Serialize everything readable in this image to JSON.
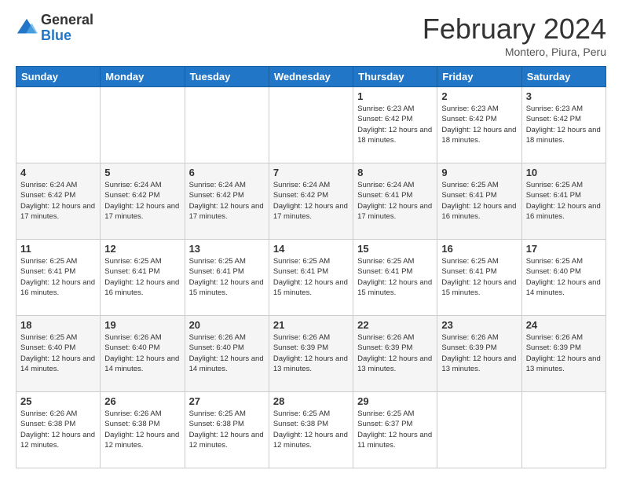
{
  "logo": {
    "general": "General",
    "blue": "Blue"
  },
  "header": {
    "month": "February 2024",
    "location": "Montero, Piura, Peru"
  },
  "weekdays": [
    "Sunday",
    "Monday",
    "Tuesday",
    "Wednesday",
    "Thursday",
    "Friday",
    "Saturday"
  ],
  "rows": [
    [
      {
        "day": "",
        "info": ""
      },
      {
        "day": "",
        "info": ""
      },
      {
        "day": "",
        "info": ""
      },
      {
        "day": "",
        "info": ""
      },
      {
        "day": "1",
        "info": "Sunrise: 6:23 AM\nSunset: 6:42 PM\nDaylight: 12 hours\nand 18 minutes."
      },
      {
        "day": "2",
        "info": "Sunrise: 6:23 AM\nSunset: 6:42 PM\nDaylight: 12 hours\nand 18 minutes."
      },
      {
        "day": "3",
        "info": "Sunrise: 6:23 AM\nSunset: 6:42 PM\nDaylight: 12 hours\nand 18 minutes."
      }
    ],
    [
      {
        "day": "4",
        "info": "Sunrise: 6:24 AM\nSunset: 6:42 PM\nDaylight: 12 hours\nand 17 minutes."
      },
      {
        "day": "5",
        "info": "Sunrise: 6:24 AM\nSunset: 6:42 PM\nDaylight: 12 hours\nand 17 minutes."
      },
      {
        "day": "6",
        "info": "Sunrise: 6:24 AM\nSunset: 6:42 PM\nDaylight: 12 hours\nand 17 minutes."
      },
      {
        "day": "7",
        "info": "Sunrise: 6:24 AM\nSunset: 6:42 PM\nDaylight: 12 hours\nand 17 minutes."
      },
      {
        "day": "8",
        "info": "Sunrise: 6:24 AM\nSunset: 6:41 PM\nDaylight: 12 hours\nand 17 minutes."
      },
      {
        "day": "9",
        "info": "Sunrise: 6:25 AM\nSunset: 6:41 PM\nDaylight: 12 hours\nand 16 minutes."
      },
      {
        "day": "10",
        "info": "Sunrise: 6:25 AM\nSunset: 6:41 PM\nDaylight: 12 hours\nand 16 minutes."
      }
    ],
    [
      {
        "day": "11",
        "info": "Sunrise: 6:25 AM\nSunset: 6:41 PM\nDaylight: 12 hours\nand 16 minutes."
      },
      {
        "day": "12",
        "info": "Sunrise: 6:25 AM\nSunset: 6:41 PM\nDaylight: 12 hours\nand 16 minutes."
      },
      {
        "day": "13",
        "info": "Sunrise: 6:25 AM\nSunset: 6:41 PM\nDaylight: 12 hours\nand 15 minutes."
      },
      {
        "day": "14",
        "info": "Sunrise: 6:25 AM\nSunset: 6:41 PM\nDaylight: 12 hours\nand 15 minutes."
      },
      {
        "day": "15",
        "info": "Sunrise: 6:25 AM\nSunset: 6:41 PM\nDaylight: 12 hours\nand 15 minutes."
      },
      {
        "day": "16",
        "info": "Sunrise: 6:25 AM\nSunset: 6:41 PM\nDaylight: 12 hours\nand 15 minutes."
      },
      {
        "day": "17",
        "info": "Sunrise: 6:25 AM\nSunset: 6:40 PM\nDaylight: 12 hours\nand 14 minutes."
      }
    ],
    [
      {
        "day": "18",
        "info": "Sunrise: 6:25 AM\nSunset: 6:40 PM\nDaylight: 12 hours\nand 14 minutes."
      },
      {
        "day": "19",
        "info": "Sunrise: 6:26 AM\nSunset: 6:40 PM\nDaylight: 12 hours\nand 14 minutes."
      },
      {
        "day": "20",
        "info": "Sunrise: 6:26 AM\nSunset: 6:40 PM\nDaylight: 12 hours\nand 14 minutes."
      },
      {
        "day": "21",
        "info": "Sunrise: 6:26 AM\nSunset: 6:39 PM\nDaylight: 12 hours\nand 13 minutes."
      },
      {
        "day": "22",
        "info": "Sunrise: 6:26 AM\nSunset: 6:39 PM\nDaylight: 12 hours\nand 13 minutes."
      },
      {
        "day": "23",
        "info": "Sunrise: 6:26 AM\nSunset: 6:39 PM\nDaylight: 12 hours\nand 13 minutes."
      },
      {
        "day": "24",
        "info": "Sunrise: 6:26 AM\nSunset: 6:39 PM\nDaylight: 12 hours\nand 13 minutes."
      }
    ],
    [
      {
        "day": "25",
        "info": "Sunrise: 6:26 AM\nSunset: 6:38 PM\nDaylight: 12 hours\nand 12 minutes."
      },
      {
        "day": "26",
        "info": "Sunrise: 6:26 AM\nSunset: 6:38 PM\nDaylight: 12 hours\nand 12 minutes."
      },
      {
        "day": "27",
        "info": "Sunrise: 6:25 AM\nSunset: 6:38 PM\nDaylight: 12 hours\nand 12 minutes."
      },
      {
        "day": "28",
        "info": "Sunrise: 6:25 AM\nSunset: 6:38 PM\nDaylight: 12 hours\nand 12 minutes."
      },
      {
        "day": "29",
        "info": "Sunrise: 6:25 AM\nSunset: 6:37 PM\nDaylight: 12 hours\nand 11 minutes."
      },
      {
        "day": "",
        "info": ""
      },
      {
        "day": "",
        "info": ""
      }
    ]
  ]
}
